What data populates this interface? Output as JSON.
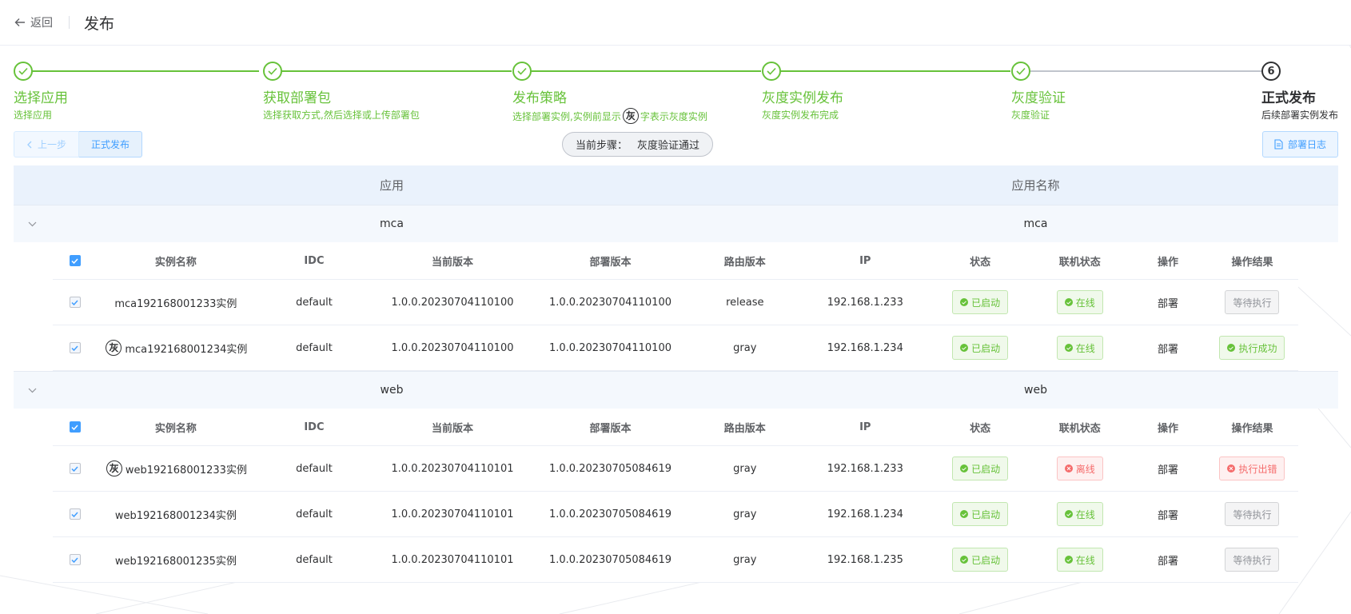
{
  "header": {
    "back_label": "返回",
    "title": "发布"
  },
  "steps": [
    {
      "title": "选择应用",
      "desc": "选择应用",
      "status": "done"
    },
    {
      "title": "获取部署包",
      "desc": "选择获取方式,然后选择或上传部署包",
      "status": "done"
    },
    {
      "title": "发布策略",
      "desc_pre": "选择部署实例,实例前显示",
      "desc_mark": "灰",
      "desc_post": "字表示灰度实例",
      "status": "done"
    },
    {
      "title": "灰度实例发布",
      "desc": "灰度实例发布完成",
      "status": "done"
    },
    {
      "title": "灰度验证",
      "desc": "灰度验证",
      "status": "done"
    },
    {
      "title": "正式发布",
      "desc": "后续部署实例发布",
      "status": "current",
      "number": "6"
    }
  ],
  "toolbar": {
    "prev_label": "上一步",
    "publish_label": "正式发布",
    "current_step_label": "当前步骤：",
    "current_step_value": "灰度验证通过",
    "log_label": "部署日志"
  },
  "main_table": {
    "headers": {
      "app": "应用",
      "app_name": "应用名称"
    },
    "sub_headers": {
      "name": "实例名称",
      "idc": "IDC",
      "current_version": "当前版本",
      "deploy_version": "部署版本",
      "route_version": "路由版本",
      "ip": "IP",
      "status": "状态",
      "online": "联机状态",
      "operation": "操作",
      "result": "操作结果"
    },
    "groups": [
      {
        "app": "mca",
        "app_name": "mca",
        "rows": [
          {
            "gray": false,
            "name": "mca192168001233实例",
            "idc": "default",
            "current_version": "1.0.0.20230704110100",
            "deploy_version": "1.0.0.20230704110100",
            "route_version": "release",
            "ip": "192.168.1.233",
            "status": "已启动",
            "online": "在线",
            "online_ok": true,
            "operation": "部署",
            "result": "等待执行",
            "result_type": "info"
          },
          {
            "gray": true,
            "gray_mark": "灰",
            "name": "mca192168001234实例",
            "idc": "default",
            "current_version": "1.0.0.20230704110100",
            "deploy_version": "1.0.0.20230704110100",
            "route_version": "gray",
            "ip": "192.168.1.234",
            "status": "已启动",
            "online": "在线",
            "online_ok": true,
            "operation": "部署",
            "result": "执行成功",
            "result_type": "success"
          }
        ]
      },
      {
        "app": "web",
        "app_name": "web",
        "rows": [
          {
            "gray": true,
            "gray_mark": "灰",
            "name": "web192168001233实例",
            "idc": "default",
            "current_version": "1.0.0.20230704110101",
            "deploy_version": "1.0.0.20230705084619",
            "route_version": "gray",
            "ip": "192.168.1.233",
            "status": "已启动",
            "online": "离线",
            "online_ok": false,
            "operation": "部署",
            "result": "执行出错",
            "result_type": "danger"
          },
          {
            "gray": false,
            "name": "web192168001234实例",
            "idc": "default",
            "current_version": "1.0.0.20230704110101",
            "deploy_version": "1.0.0.20230705084619",
            "route_version": "gray",
            "ip": "192.168.1.234",
            "status": "已启动",
            "online": "在线",
            "online_ok": true,
            "operation": "部署",
            "result": "等待执行",
            "result_type": "info"
          },
          {
            "gray": false,
            "name": "web192168001235实例",
            "idc": "default",
            "current_version": "1.0.0.20230704110101",
            "deploy_version": "1.0.0.20230705084619",
            "route_version": "gray",
            "ip": "192.168.1.235",
            "status": "已启动",
            "online": "在线",
            "online_ok": true,
            "operation": "部署",
            "result": "等待执行",
            "result_type": "info"
          }
        ]
      }
    ]
  },
  "colors": {
    "success": "#67c23a",
    "danger": "#f56c6c",
    "primary": "#409eff",
    "info": "#909399",
    "header_bg": "#eaf2fc"
  },
  "icons": {
    "back": "arrow-left-icon",
    "step_done": "check-icon",
    "prev": "chevron-left-icon",
    "log": "document-icon",
    "expand": "chevron-down-icon",
    "checkbox": "checkbox-icon"
  }
}
